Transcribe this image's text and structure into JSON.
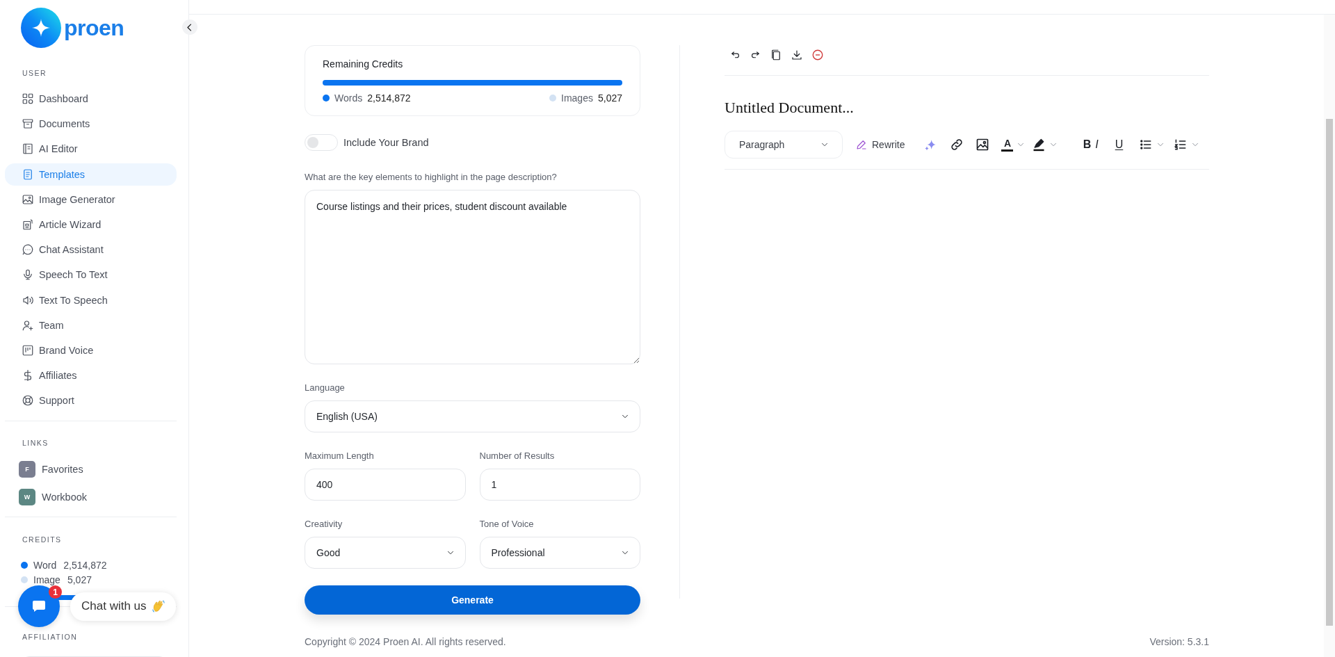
{
  "logo": {
    "text": "proen"
  },
  "sidebar": {
    "user_heading": "USER",
    "user_items": [
      {
        "label": "Dashboard",
        "selected": false
      },
      {
        "label": "Documents",
        "selected": false
      },
      {
        "label": "AI Editor",
        "selected": false
      },
      {
        "label": "Templates",
        "selected": true
      },
      {
        "label": "Image Generator",
        "selected": false
      },
      {
        "label": "Article Wizard",
        "selected": false
      },
      {
        "label": "Chat Assistant",
        "selected": false
      },
      {
        "label": "Speech To Text",
        "selected": false
      },
      {
        "label": "Text To Speech",
        "selected": false
      },
      {
        "label": "Team",
        "selected": false
      },
      {
        "label": "Brand Voice",
        "selected": false
      },
      {
        "label": "Affiliates",
        "selected": false
      },
      {
        "label": "Support",
        "selected": false
      }
    ],
    "links_heading": "LINKS",
    "links": [
      {
        "initial": "F",
        "label": "Favorites",
        "color": "#7a7e90"
      },
      {
        "initial": "W",
        "label": "Workbook",
        "color": "#5c8783"
      }
    ],
    "credits_heading": "CREDITS",
    "credits": [
      {
        "label": "Word",
        "value": "2,514,872",
        "color": "#0a74f0"
      },
      {
        "label": "Image",
        "value": "5,027",
        "color": "#d3e2f3"
      }
    ],
    "credits_bar": {
      "level": 1
    },
    "affiliation_heading": "AFFILIATION"
  },
  "chat_widget": {
    "badge": "1",
    "label": "Chat with us"
  },
  "credits_card": {
    "title": "Remaining Credits",
    "level": 1,
    "items": [
      {
        "label": "Words",
        "value": "2,514,872",
        "color": "#0a74f0"
      },
      {
        "label": "Images",
        "value": "5,027",
        "color": "#d3e2f3"
      }
    ]
  },
  "brand_toggle": {
    "label": "Include Your Brand",
    "on": false
  },
  "form_rows": [
    [
      {
        "kind": "textarea",
        "label": "What are the key elements to highlight in the page description?",
        "value": "Course listings and their prices, student discount available"
      }
    ],
    [
      {
        "kind": "select",
        "label": "Language",
        "value": "English (USA)"
      }
    ],
    [
      {
        "kind": "input",
        "label": "Maximum Length",
        "value": "400"
      },
      {
        "kind": "input",
        "label": "Number of Results",
        "value": "1"
      }
    ],
    [
      {
        "kind": "select",
        "label": "Creativity",
        "value": "Good"
      },
      {
        "kind": "select",
        "label": "Tone of Voice",
        "value": "Professional"
      }
    ]
  ],
  "generate_button": "Generate",
  "editor": {
    "title": "Untitled Document...",
    "block_format": "Paragraph",
    "rewrite": "Rewrite",
    "text_color": "A",
    "format_buttons": [
      {
        "kind": "bold",
        "label": "B"
      },
      {
        "kind": "italic",
        "label": "I"
      },
      {
        "kind": "underline",
        "label": "U"
      }
    ]
  },
  "footer": {
    "copyright": "Copyright © 2024 Proen AI. All rights reserved.",
    "version": "Version: 5.3.1"
  }
}
